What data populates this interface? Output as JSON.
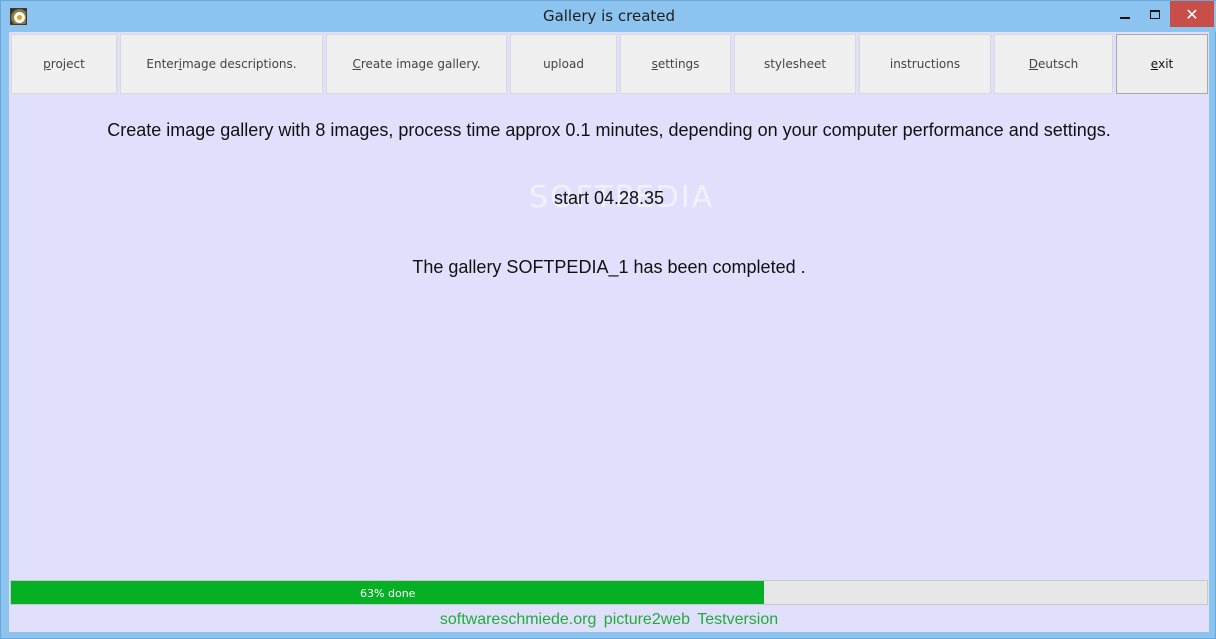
{
  "window": {
    "title": "Gallery is created",
    "icon": "gallery-app-icon",
    "controls": {
      "minimize": "minimize-icon",
      "maximize": "maximize-icon",
      "close": "close-icon"
    }
  },
  "toolbar": {
    "buttons": [
      {
        "key": "p",
        "rest": "roject"
      },
      {
        "pre": "Enter ",
        "key": "i",
        "rest": "mage descriptions."
      },
      {
        "key": "C",
        "rest": "reate image gallery."
      },
      {
        "label": "upload"
      },
      {
        "key": "s",
        "rest": "ettings"
      },
      {
        "label": "stylesheet"
      },
      {
        "label": "instructions"
      },
      {
        "key": "D",
        "rest": "eutsch"
      },
      {
        "key": "e",
        "rest": "xit"
      }
    ]
  },
  "main": {
    "process_message": "Create image gallery with 8 images, process time approx 0.1 minutes, depending on your computer performance and settings.",
    "start_message": "start 04.28.35",
    "completion_message": "The gallery SOFTPEDIA_1 has been completed ."
  },
  "watermark": "SOFTPEDIA",
  "progress": {
    "percent": 63,
    "label": "63% done",
    "fill_color": "#06b025"
  },
  "footer": {
    "text": "softwareschmiede.org  picture2web  Testversion",
    "color": "#23aa3a"
  },
  "colors": {
    "titlebar": "#8cc3ef",
    "client_background": "#e0e0fd",
    "close_button": "#c74f48"
  }
}
